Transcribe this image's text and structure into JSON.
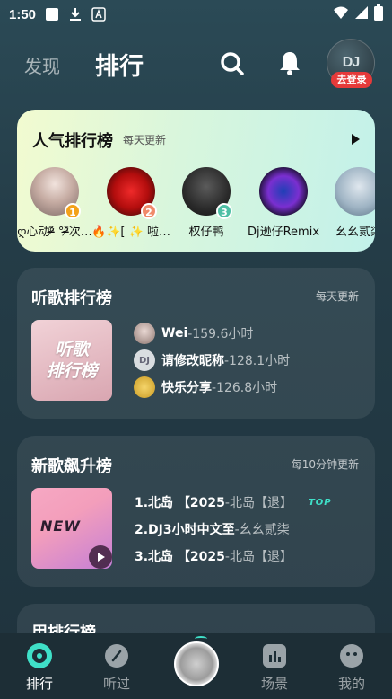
{
  "status_bar": {
    "time": "1:50"
  },
  "header": {
    "tab_discover": "发现",
    "tab_rank": "排行",
    "avatar_text": "DJ",
    "login_badge": "去登录"
  },
  "popular": {
    "title": "人气排行榜",
    "subtitle": "每天更新",
    "items": [
      {
        "name": "ღ心动ᵒ̴̶̷᷄ °ᵒ̴̶̷᷅次…",
        "rank": "1",
        "rank_color": "#f3a21a"
      },
      {
        "name": "🔥✨[ ✨ 啦…",
        "rank": "2",
        "rank_color": "#f08a6a"
      },
      {
        "name": "权仔鸭",
        "rank": "3",
        "rank_color": "#4fbfa5"
      },
      {
        "name": "Dj逊仔Remix",
        "rank": ""
      },
      {
        "name": "幺幺贰柒",
        "rank": ""
      }
    ]
  },
  "listen_chart": {
    "title": "听歌排行榜",
    "subtitle": "每天更新",
    "cover_line1": "听歌",
    "cover_line2": "排行榜",
    "rows": [
      {
        "name": "Wei",
        "value": "-159.6小时"
      },
      {
        "name": "请修改昵称",
        "value": "-128.1小时"
      },
      {
        "name": "快乐分享",
        "value": "-126.8小时"
      }
    ]
  },
  "new_songs": {
    "title": "新歌飙升榜",
    "subtitle": "每10分钟更新",
    "cover_text": "NEW",
    "rows": [
      {
        "title": "1.北岛 【2025",
        "artist": "-北岛【退】",
        "tag": "TOP"
      },
      {
        "title": "2.DJ3小时中文至",
        "artist": "-幺幺贰柒",
        "tag": ""
      },
      {
        "title": "3.北岛 【2025",
        "artist": "-北岛【退】",
        "tag": ""
      }
    ]
  },
  "peek_card": {
    "title": "用排行榜"
  },
  "bottom_nav": {
    "items": [
      {
        "label": "排行",
        "active": true
      },
      {
        "label": "听过",
        "active": false
      },
      {
        "label": "场景",
        "active": false
      },
      {
        "label": "我的",
        "active": false
      }
    ]
  },
  "colors": {
    "accent": "#3fe0c8",
    "badge_red": "#e63a3a"
  }
}
